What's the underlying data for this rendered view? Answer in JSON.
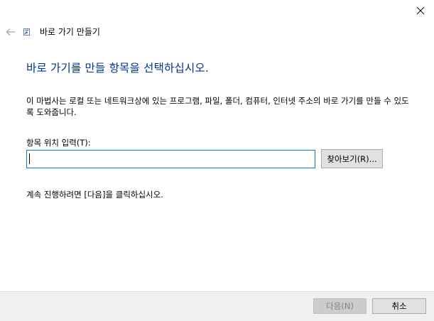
{
  "window": {
    "title": "바로 가기 만들기",
    "close_icon": "close-icon",
    "back_icon": "back-arrow-icon"
  },
  "main": {
    "instruction": "바로 가기를 만들 항목을 선택하십시오.",
    "description": "이 마법사는 로컬 또는 네트워크상에 있는 프로그램, 파일, 폴더, 컴퓨터, 인터넷 주소의 바로 가기를 만들 수 있도록 도와줍니다.",
    "field_label": "항목 위치 입력(T):",
    "location_value": "",
    "browse_label": "찾아보기(R)...",
    "continue_text": "계속 진행하려면 [다음]을 클릭하십시오."
  },
  "footer": {
    "next_label": "다음(N)",
    "cancel_label": "취소"
  },
  "colors": {
    "instruction": "#003399",
    "input_border": "#0078d7",
    "footer_bg": "#f0f0f0"
  }
}
